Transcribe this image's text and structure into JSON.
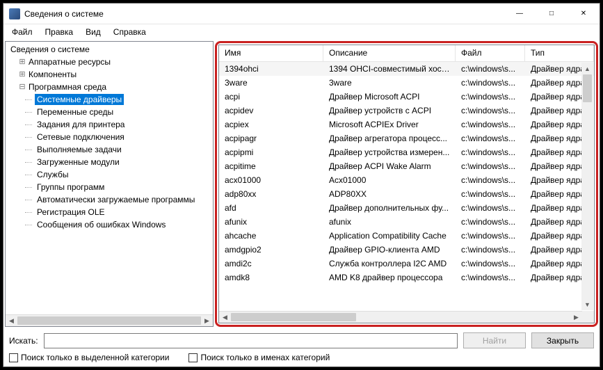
{
  "window": {
    "title": "Сведения о системе"
  },
  "menu": {
    "file": "Файл",
    "edit": "Правка",
    "view": "Вид",
    "help": "Справка"
  },
  "tree": {
    "root": "Сведения о системе",
    "hardware": "Аппаратные ресурсы",
    "components": "Компоненты",
    "software_env": "Программная среда",
    "items": {
      "system_drivers": "Системные драйверы",
      "env_vars": "Переменные среды",
      "print_jobs": "Задания для принтера",
      "net_conn": "Сетевые подключения",
      "running_tasks": "Выполняемые задачи",
      "loaded_modules": "Загруженные модули",
      "services": "Службы",
      "program_groups": "Группы программ",
      "autostart": "Автоматически загружаемые программы",
      "ole_reg": "Регистрация OLE",
      "win_err": "Сообщения об ошибках Windows"
    }
  },
  "columns": {
    "name": "Имя",
    "desc": "Описание",
    "file": "Файл",
    "type": "Тип"
  },
  "rows": [
    {
      "name": "1394ohci",
      "desc": "1394 OHCI-совместимый хост...",
      "file": "c:\\windows\\s...",
      "type": "Драйвер ядра"
    },
    {
      "name": "3ware",
      "desc": "3ware",
      "file": "c:\\windows\\s...",
      "type": "Драйвер ядра"
    },
    {
      "name": "acpi",
      "desc": "Драйвер Microsoft ACPI",
      "file": "c:\\windows\\s...",
      "type": "Драйвер ядра"
    },
    {
      "name": "acpidev",
      "desc": "Драйвер устройств с ACPI",
      "file": "c:\\windows\\s...",
      "type": "Драйвер ядра"
    },
    {
      "name": "acpiex",
      "desc": "Microsoft ACPIEx Driver",
      "file": "c:\\windows\\s...",
      "type": "Драйвер ядра"
    },
    {
      "name": "acpipagr",
      "desc": "Драйвер агрегатора процесс...",
      "file": "c:\\windows\\s...",
      "type": "Драйвер ядра"
    },
    {
      "name": "acpipmi",
      "desc": "Драйвер устройства измерен...",
      "file": "c:\\windows\\s...",
      "type": "Драйвер ядра"
    },
    {
      "name": "acpitime",
      "desc": "Драйвер ACPI Wake Alarm",
      "file": "c:\\windows\\s...",
      "type": "Драйвер ядра"
    },
    {
      "name": "acx01000",
      "desc": "Acx01000",
      "file": "c:\\windows\\s...",
      "type": "Драйвер ядра"
    },
    {
      "name": "adp80xx",
      "desc": "ADP80XX",
      "file": "c:\\windows\\s...",
      "type": "Драйвер ядра"
    },
    {
      "name": "afd",
      "desc": "Драйвер дополнительных фу...",
      "file": "c:\\windows\\s...",
      "type": "Драйвер ядра"
    },
    {
      "name": "afunix",
      "desc": "afunix",
      "file": "c:\\windows\\s...",
      "type": "Драйвер ядра"
    },
    {
      "name": "ahcache",
      "desc": "Application Compatibility Cache",
      "file": "c:\\windows\\s...",
      "type": "Драйвер ядра"
    },
    {
      "name": "amdgpio2",
      "desc": "Драйвер GPIO-клиента AMD",
      "file": "c:\\windows\\s...",
      "type": "Драйвер ядра"
    },
    {
      "name": "amdi2c",
      "desc": "Служба контроллера I2C AMD",
      "file": "c:\\windows\\s...",
      "type": "Драйвер ядра"
    },
    {
      "name": "amdk8",
      "desc": "AMD K8 драйвер процессора",
      "file": "c:\\windows\\s...",
      "type": "Драйвер ядра"
    }
  ],
  "bottom": {
    "search_label": "Искать:",
    "find_btn": "Найти",
    "close_btn": "Закрыть",
    "selected_cat": "Поиск только в выделенной категории",
    "names_only": "Поиск только в именах категорий"
  }
}
